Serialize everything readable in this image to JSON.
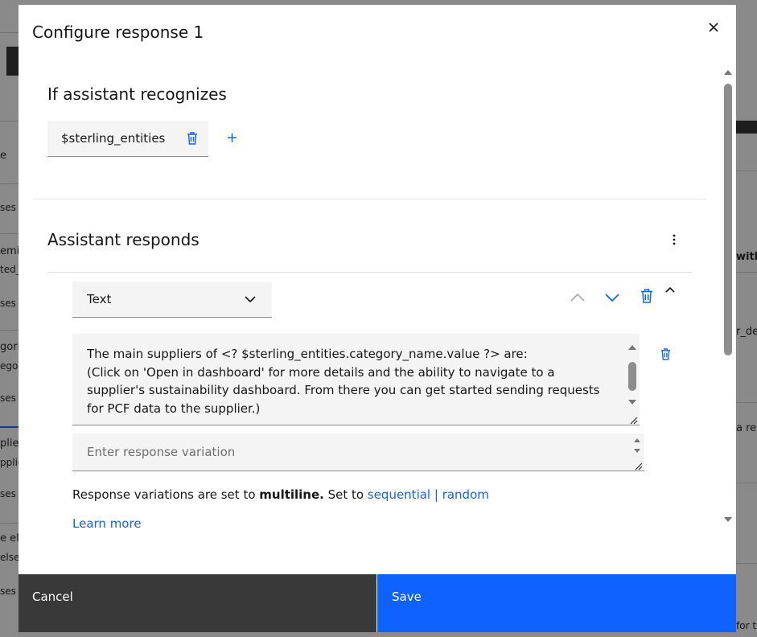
{
  "background": {
    "fragments": [
      "e",
      "ses /",
      "emi",
      "ted_",
      "ses /",
      "gori",
      "egor",
      "ses /",
      "plier",
      "pplie",
      "ses /",
      "e els",
      "else",
      "ses /",
      "with",
      "r_de",
      "a res",
      "for t"
    ]
  },
  "modal": {
    "title": "Configure response 1",
    "close_icon": "close-icon"
  },
  "recognizes": {
    "heading": "If assistant recognizes",
    "condition_chip": "$sterling_entities",
    "add_label": "+"
  },
  "responds": {
    "heading": "Assistant responds",
    "response_type": "Text",
    "response_text": "The main suppliers of <? $sterling_entities.category_name.value ?> are:\n(Click on 'Open in dashboard' for more details and the ability to navigate to a supplier's sustainability dashboard. From there you can get started sending requests for PCF data to the supplier.)",
    "variation_placeholder": "Enter response variation",
    "variation_note_prefix": "Response variations are set to ",
    "variation_mode": "multiline.",
    "variation_note_middle": " Set to ",
    "option_sequential": "sequential",
    "separator": " | ",
    "option_random": "random",
    "learn_more": "Learn more"
  },
  "footer": {
    "cancel_label": "Cancel",
    "save_label": "Save"
  },
  "colors": {
    "primary": "#0f62fe",
    "dark_button": "#393939",
    "field_bg": "#f4f4f4"
  }
}
